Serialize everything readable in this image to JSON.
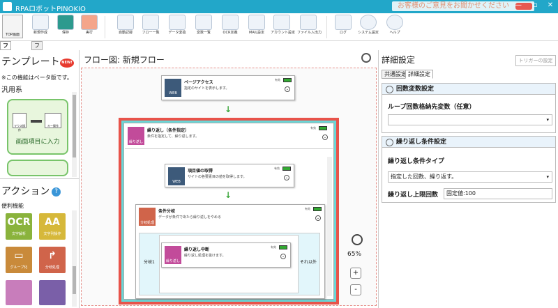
{
  "window": {
    "title": "RPAロボットPINOKIO",
    "feedback": "お客様のご意見をお聞かせください",
    "min": "—",
    "max": "▫",
    "close": "✕"
  },
  "ribbon": {
    "items": [
      "TOP画面",
      "新規作成",
      "保存",
      "実行",
      "自動記録",
      "フロー一覧",
      "データ変換",
      "変数一覧",
      "OCR定義",
      "MAIL設定",
      "アカウント設定",
      "ファイル入出力",
      "ログ",
      "システム設定",
      "ヘルプ"
    ]
  },
  "tabs": [
    "フロー作成",
    "フロー設定"
  ],
  "left": {
    "template_title": "テンプレート",
    "new_badge": "NEW!",
    "note": "※この機能はベータ版です。",
    "category": "汎用系",
    "template_tile": "画面項目に入力",
    "tile_sub1": "マウス操作",
    "tile_sub2": "キー操作",
    "action_title": "アクション",
    "help": "?",
    "action_category": "便利機能",
    "actions": [
      {
        "icon": "OCR",
        "label": "文字解析"
      },
      {
        "icon": "AA",
        "label": "文字列操作"
      },
      {
        "icon": "▭",
        "label": "グループ化"
      },
      {
        "icon": "↱",
        "label": "分岐処理"
      }
    ]
  },
  "center": {
    "title": "フロー図: 新規フロー",
    "zoom": "65%",
    "plus": "+",
    "minus": "-",
    "node1": {
      "title": "ページアクセス",
      "desc": "指定のサイトを表示します。",
      "icon": "WEB",
      "badge": "有効"
    },
    "loop": {
      "title": "繰り返し（条件指定）",
      "desc": "条件を指定して、繰り返します。",
      "icon": "繰り返し",
      "badge": "有効"
    },
    "node2": {
      "title": "項目値の取得",
      "desc": "サイトの各要素目の値を取得します。",
      "icon": "WEB",
      "badge": "有効"
    },
    "cond": {
      "title": "条件分岐",
      "desc": "データが条件であたら繰り返しをやめる",
      "icon": "分岐処理",
      "badge": "有効"
    },
    "node3": {
      "title": "繰り返し中断",
      "desc": "繰り返し処理を抜けます。",
      "icon": "繰り返し",
      "badge": "有効"
    },
    "branch1": "分岐1",
    "else": "それ以外"
  },
  "right": {
    "title": "詳細設定",
    "trigger": "トリガーの設定",
    "tabs": [
      "共通設定",
      "詳細設定"
    ],
    "sec1": "回数変数設定",
    "loopvar_label": "ループ回数格納先変数（任意）",
    "loopvar_value": "",
    "sec2": "繰り返し条件設定",
    "type_label": "繰り返し条件タイプ",
    "type_value": "指定した回数、繰り返す。",
    "limit_label": "繰り返し上限回数",
    "limit_value": "固定値:100"
  },
  "colors": {
    "accent": "#22a7c9",
    "loop_border": "#e8534a",
    "loop_inner": "#6ad6d6",
    "green": "#3aa53a"
  }
}
